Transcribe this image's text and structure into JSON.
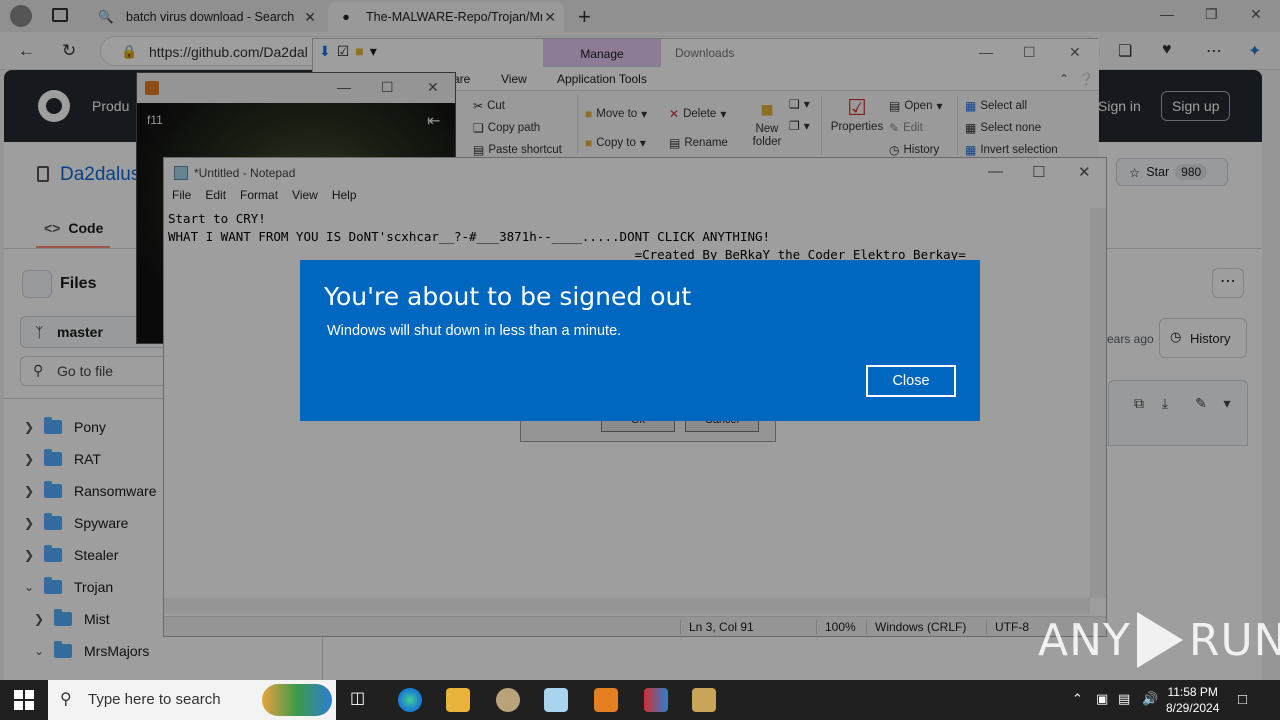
{
  "browser": {
    "tabs": [
      {
        "label": "batch virus download - Search"
      },
      {
        "label": "The-MALWARE-Repo/Trojan/Mr"
      }
    ],
    "url": "https://github.com/Da2dal"
  },
  "github": {
    "product_label": "Produ",
    "sign_in": "Sign in",
    "sign_up": "Sign up",
    "repo_owner": "Da2dalus",
    "star_label": "Star",
    "star_count": "980",
    "code_tab": "Code",
    "files_title": "Files",
    "branch": "master",
    "goto_placeholder": "Go to file",
    "tree": [
      {
        "label": "Pony",
        "expanded": false
      },
      {
        "label": "RAT",
        "expanded": false
      },
      {
        "label": "Ransomware",
        "expanded": false
      },
      {
        "label": "Spyware",
        "expanded": false
      },
      {
        "label": "Stealer",
        "expanded": false
      },
      {
        "label": "Trojan",
        "expanded": true
      },
      {
        "label": "Mist",
        "expanded": false
      },
      {
        "label": "MrsMajors",
        "expanded": true
      }
    ],
    "years_ago": "ears ago",
    "history": "History"
  },
  "explorer": {
    "manage": "Manage",
    "title": "Downloads",
    "tabs": [
      "are",
      "View",
      "Application Tools"
    ],
    "ribbon": {
      "cut": "Cut",
      "copy_path": "Copy path",
      "paste_shortcut": "Paste shortcut",
      "move_to": "Move to",
      "copy_to": "Copy to",
      "delete": "Delete",
      "rename": "Rename",
      "new_folder": "New folder",
      "properties": "Properties",
      "open": "Open",
      "edit": "Edit",
      "history": "History",
      "select_all": "Select all",
      "select_none": "Select none",
      "invert_selection": "Invert selection"
    }
  },
  "media": {
    "overlay": "f11"
  },
  "notepad": {
    "title": "*Untitled - Notepad",
    "menus": [
      "File",
      "Edit",
      "Format",
      "View",
      "Help"
    ],
    "lines": [
      "Start to CRY!",
      "WHAT I WANT FROM YOU IS DoNT'scxhcar__?-#___3871h--____.....DONT CLICK ANYTHING!",
      "                                                              =Created By BeRkaY the Coder Elektro Berkay="
    ],
    "status": {
      "position": "Ln 3, Col 91",
      "zoom": "100%",
      "line_ending": "Windows (CRLF)",
      "encoding": "UTF-8"
    }
  },
  "msgbox": {
    "ok": "Ok",
    "cancel": "Cancel"
  },
  "dialog": {
    "title": "You're about to be signed out",
    "message": "Windows will shut down in less than a minute.",
    "close": "Close",
    "background_color": "#0067c0"
  },
  "watermark": {
    "left": "ANY",
    "right": "RUN"
  },
  "taskbar": {
    "search_placeholder": "Type here to search",
    "time": "11:58 PM",
    "date": "8/29/2024"
  }
}
